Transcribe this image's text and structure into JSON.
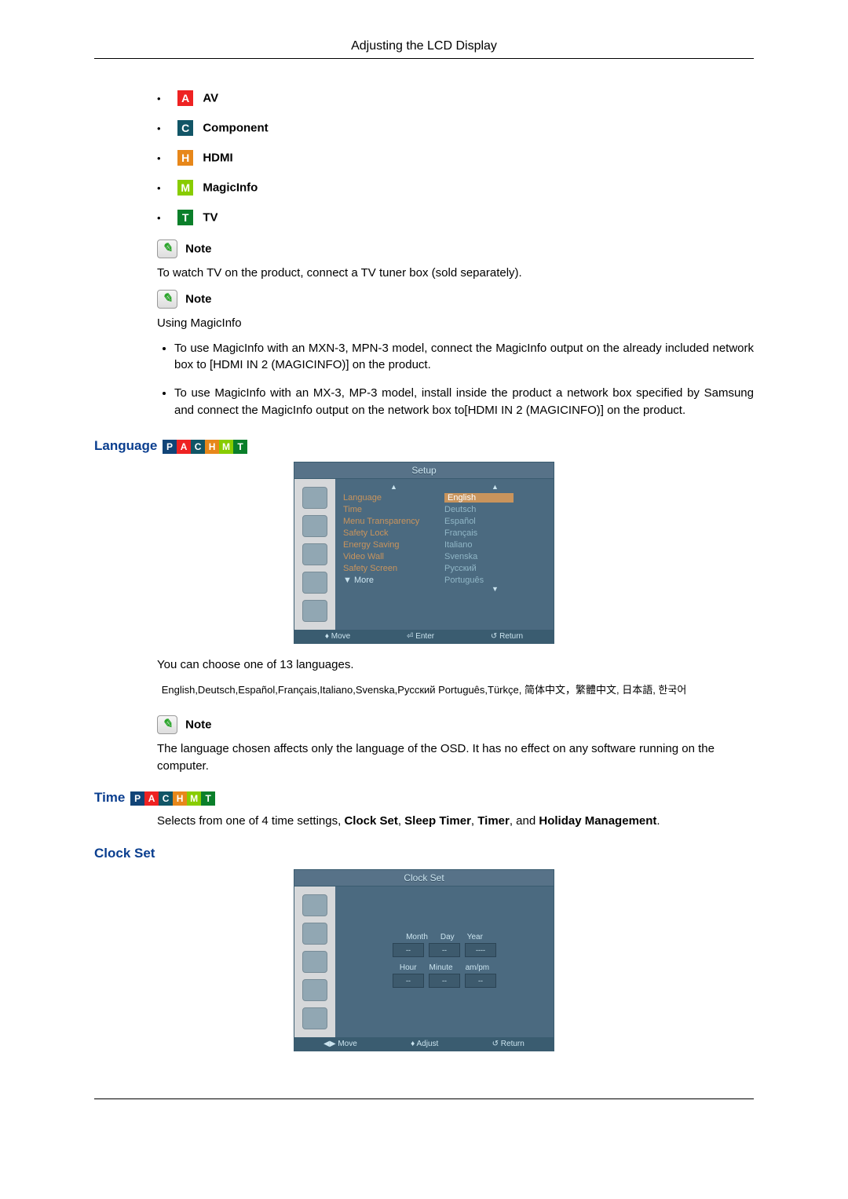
{
  "header": "Adjusting the LCD Display",
  "sources": [
    {
      "letter": "A",
      "class": "badge-a",
      "label": "AV"
    },
    {
      "letter": "C",
      "class": "badge-c",
      "label": "Component"
    },
    {
      "letter": "H",
      "class": "badge-h",
      "label": "HDMI"
    },
    {
      "letter": "M",
      "class": "badge-m",
      "label": "MagicInfo"
    },
    {
      "letter": "T",
      "class": "badge-t",
      "label": "TV"
    }
  ],
  "note_label": "Note",
  "note_tv": "To watch TV on the product, connect a TV tuner box (sold separately).",
  "note_usingmi": "Using MagicInfo",
  "mi_bullets": [
    "To use MagicInfo with an MXN-3, MPN-3 model, connect the MagicInfo output on the already included network box to [HDMI IN 2 (MAGICINFO)] on the product.",
    "To use MagicInfo with an MX-3, MP-3 model, install inside the product a network box specified by Samsung and connect the MagicInfo output on the network box to[HDMI IN 2 (MAGICINFO)] on the product."
  ],
  "section_language": "Language",
  "osd_setup": {
    "title": "Setup",
    "items": [
      "Language",
      "Time",
      "Menu Transparency",
      "Safety Lock",
      "Energy Saving",
      "Video Wall",
      "Safety Screen",
      "▼ More"
    ],
    "values": [
      "English",
      "Deutsch",
      "Español",
      "Français",
      "Italiano",
      "Svenska",
      "Русский",
      "Português"
    ],
    "footer": [
      "Move",
      "Enter",
      "Return"
    ]
  },
  "lang_choose": "You can choose one of 13 languages.",
  "lang_list": "English,Deutsch,Español,Français,Italiano,Svenska,Pусский Português,Türkçe, 简体中文，繁體中文, 日本語, 한국어",
  "lang_note": "The language chosen affects only the language of the OSD. It has no effect on any software running on the computer.",
  "section_time": "Time",
  "time_intro_a": "Selects from one of 4 time settings, ",
  "time_bold": [
    "Clock Set",
    "Sleep Timer",
    "Timer",
    "Holiday Management"
  ],
  "time_and": ", and ",
  "time_sep": ", ",
  "time_period": ".",
  "section_clockset": "Clock Set",
  "osd_clock": {
    "title": "Clock Set",
    "row1": [
      "Month",
      "Day",
      "Year"
    ],
    "row2": [
      "Hour",
      "Minute",
      "am/pm"
    ],
    "vals": [
      "--",
      "--",
      "----",
      "--",
      "--",
      "--"
    ],
    "footer": [
      "Move",
      "Adjust",
      "Return"
    ]
  }
}
